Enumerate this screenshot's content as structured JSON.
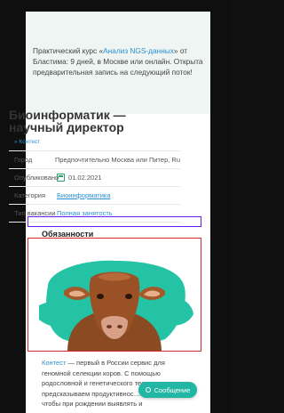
{
  "promo": {
    "text_before": "Практический курс «",
    "link": "Анализ NGS-данных",
    "text_after": "» от Бластима: 9 дней, в Москве или онлайн. Открыта предварительная запись на следующий поток!"
  },
  "job": {
    "title": "Биоинформатик — научный директор",
    "company_crumb": "» Контест",
    "rows": [
      {
        "key": "Город",
        "value": "Предпочтительно Москва или Питер, Ru"
      },
      {
        "key": "Опубликовано",
        "value": "01.02.2021"
      },
      {
        "key": "Категория",
        "value": "Биоинформатика"
      },
      {
        "key": "Тип вакансии",
        "value": "Полная занятость"
      }
    ]
  },
  "duties_heading": "Обязанности",
  "body": {
    "link": "Контест",
    "text": " — первый в России сервис для геномной селекции коров. С помощью родословной и генетического тест… предсказываем продуктивнос… животного, чтобы при рождении выявлять и"
  },
  "message_button": "Сообщение",
  "colors": {
    "accent": "#2a8fd0",
    "teal": "#22b6a4",
    "purple_box": "#6a1cf0",
    "red_box": "#d8282c"
  }
}
